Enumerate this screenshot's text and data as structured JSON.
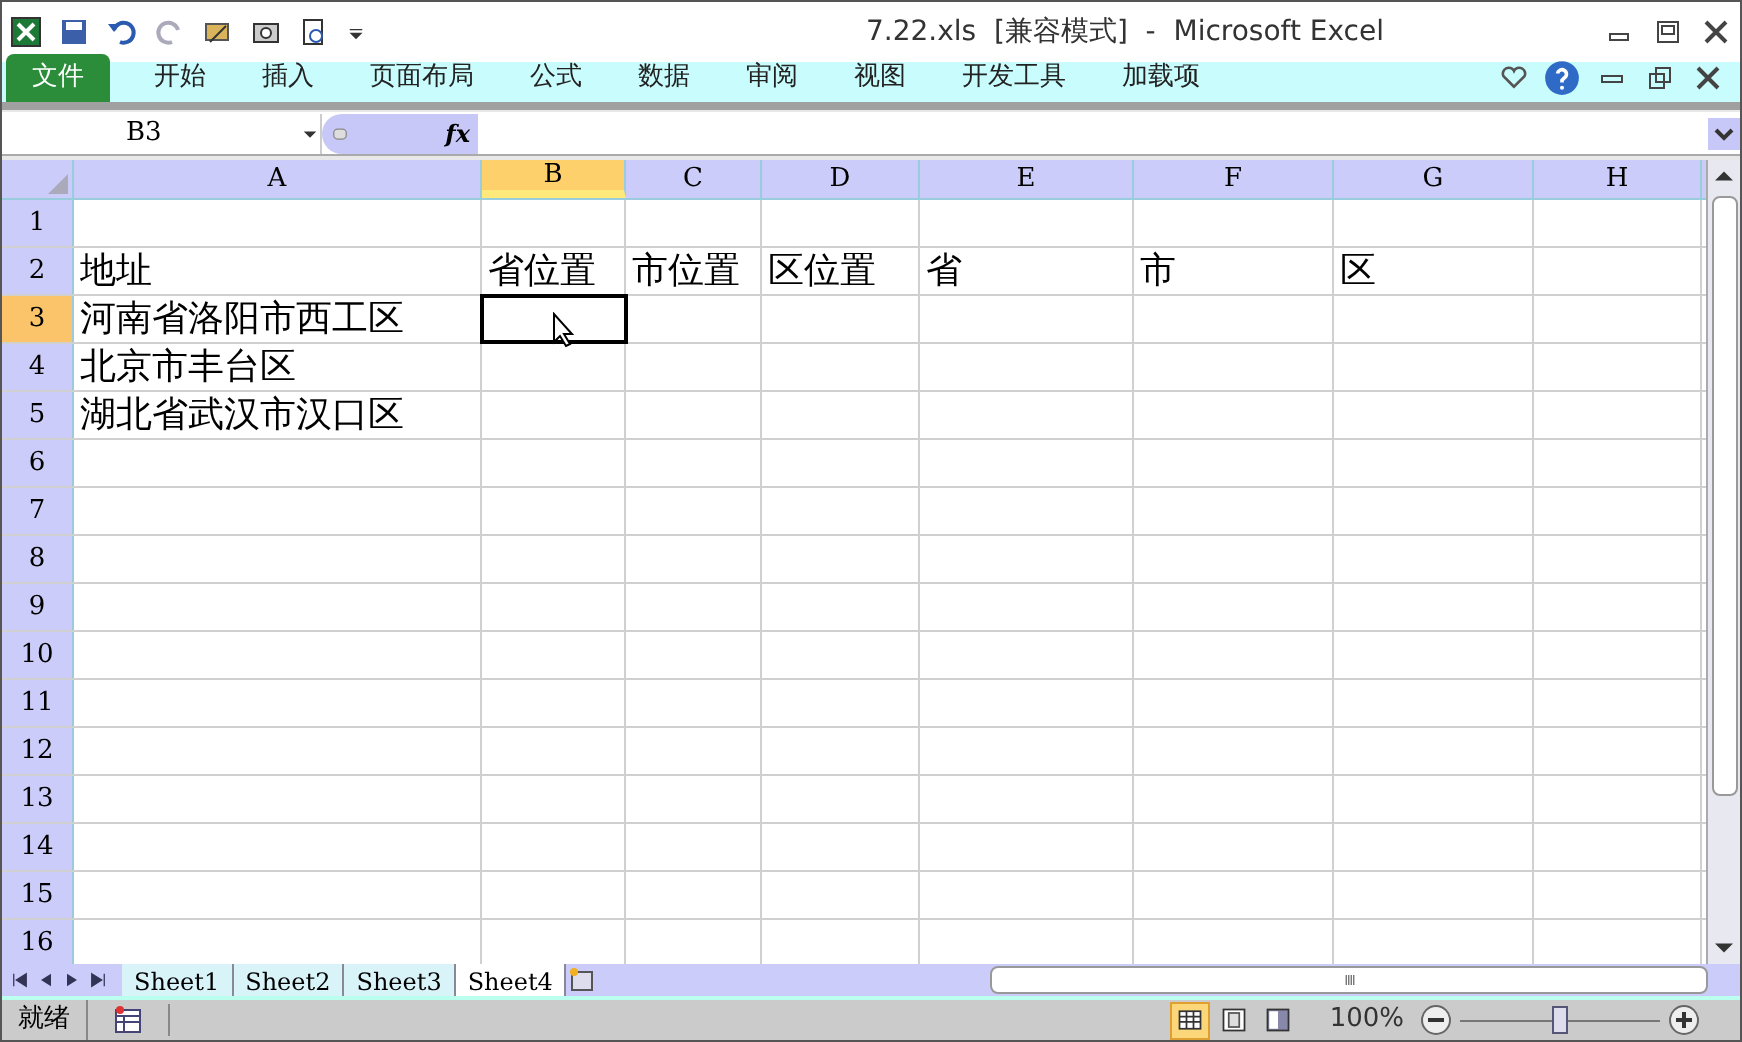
{
  "window": {
    "title": "7.22.xls  [兼容模式]  -  Microsoft Excel"
  },
  "ribbon_tabs": [
    {
      "label": "文件",
      "kind": "file"
    },
    {
      "label": "开始",
      "kind": "tab"
    },
    {
      "label": "插入",
      "kind": "tab"
    },
    {
      "label": "页面布局",
      "kind": "tab"
    },
    {
      "label": "公式",
      "kind": "tab"
    },
    {
      "label": "数据",
      "kind": "tab"
    },
    {
      "label": "审阅",
      "kind": "tab"
    },
    {
      "label": "视图",
      "kind": "tab"
    },
    {
      "label": "开发工具",
      "kind": "tab"
    },
    {
      "label": "加载项",
      "kind": "tab"
    }
  ],
  "formula_bar": {
    "name_box": "B3",
    "fx": "fx"
  },
  "columns": [
    {
      "label": "A",
      "selected": false
    },
    {
      "label": "B",
      "selected": true
    },
    {
      "label": "C",
      "selected": false
    },
    {
      "label": "D",
      "selected": false
    },
    {
      "label": "E",
      "selected": false
    },
    {
      "label": "F",
      "selected": false
    },
    {
      "label": "G",
      "selected": false
    },
    {
      "label": "H",
      "selected": false
    }
  ],
  "rows": [
    {
      "header": "1",
      "selected": false
    },
    {
      "header": "2",
      "selected": false,
      "cells": [
        "地址",
        "省位置",
        "市位置",
        "区位置",
        "省",
        "市",
        "区"
      ]
    },
    {
      "header": "3",
      "selected": true,
      "cells": [
        "河南省洛阳市西工区"
      ]
    },
    {
      "header": "4",
      "selected": false,
      "cells": [
        "北京市丰台区"
      ]
    },
    {
      "header": "5",
      "selected": false,
      "cells": [
        "湖北省武汉市汉口区"
      ]
    },
    {
      "header": "6",
      "selected": false
    },
    {
      "header": "7",
      "selected": false
    },
    {
      "header": "8",
      "selected": false
    },
    {
      "header": "9",
      "selected": false
    },
    {
      "header": "10",
      "selected": false
    },
    {
      "header": "11",
      "selected": false
    },
    {
      "header": "12",
      "selected": false
    },
    {
      "header": "13",
      "selected": false
    },
    {
      "header": "14",
      "selected": false
    },
    {
      "header": "15",
      "selected": false
    },
    {
      "header": "16",
      "selected": false
    }
  ],
  "sheet_tabs": [
    {
      "label": "Sheet1",
      "selected": false
    },
    {
      "label": "Sheet2",
      "selected": false
    },
    {
      "label": "Sheet3",
      "selected": false
    },
    {
      "label": "Sheet4",
      "selected": true
    }
  ],
  "status_bar": {
    "status": "就绪",
    "zoom": "100%",
    "zoom_slider": {
      "level": 0.5
    },
    "views": [
      {
        "kind": "normal",
        "selected": true
      },
      {
        "kind": "page-layout",
        "selected": false
      },
      {
        "kind": "page-break",
        "selected": false
      }
    ]
  }
}
